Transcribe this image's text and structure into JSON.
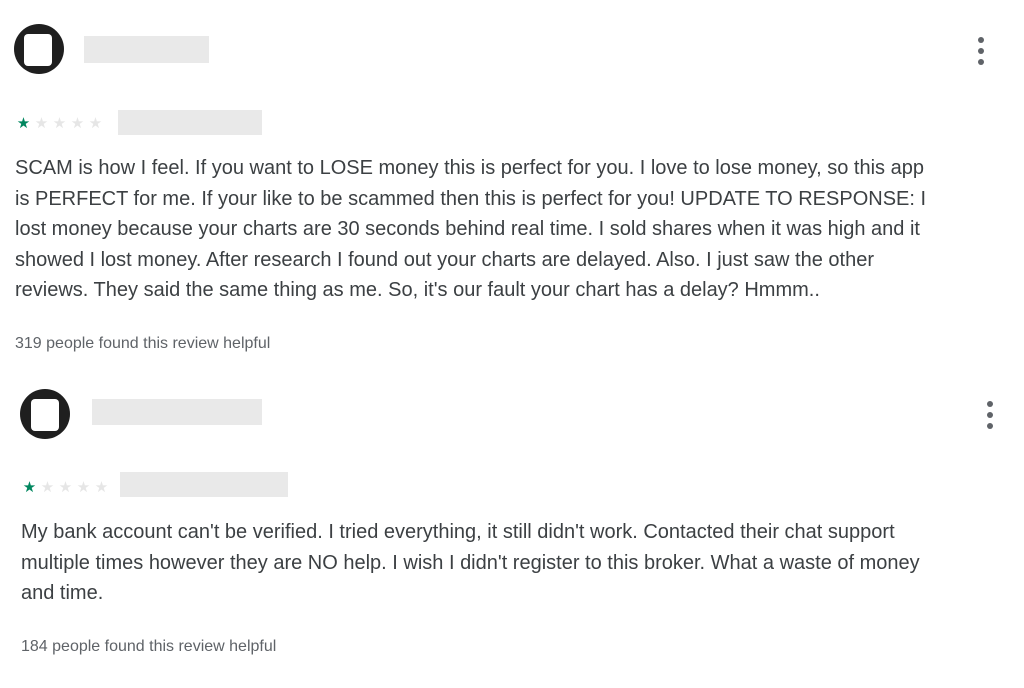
{
  "reviews": [
    {
      "rating": 1,
      "max_rating": 5,
      "avatar_icon": "user-avatar",
      "menu_icon": "more-vert-icon",
      "text": "SCAM is how I feel. If you want to LOSE money this is perfect for you. I love to lose money, so this app\nis PERFECT for me. If your like to be scammed then this is perfect for you! UPDATE TO RESPONSE: I\nlost money because your charts are 30 seconds behind real time. I sold shares when it was high and it\nshowed I lost money. After research I found out your charts are delayed. Also. I just saw the other\nreviews. They said the same thing as me. So, it's our fault your chart has a delay? Hmmm..",
      "helpful": "319 people found this review helpful"
    },
    {
      "rating": 1,
      "max_rating": 5,
      "avatar_icon": "user-avatar",
      "menu_icon": "more-vert-icon",
      "text": "My bank account can't be verified. I tried everything, it still didn't work. Contacted their chat support\nmultiple times however they are NO help. I wish I didn't register to this broker. What a waste of money\nand time.",
      "helpful": "184 people found this review helpful"
    }
  ],
  "colors": {
    "star_filled": "#01875f",
    "star_empty": "#e6e6e6",
    "text": "#3c4043",
    "muted": "#5f6368",
    "redaction": "#e9e9e9"
  }
}
